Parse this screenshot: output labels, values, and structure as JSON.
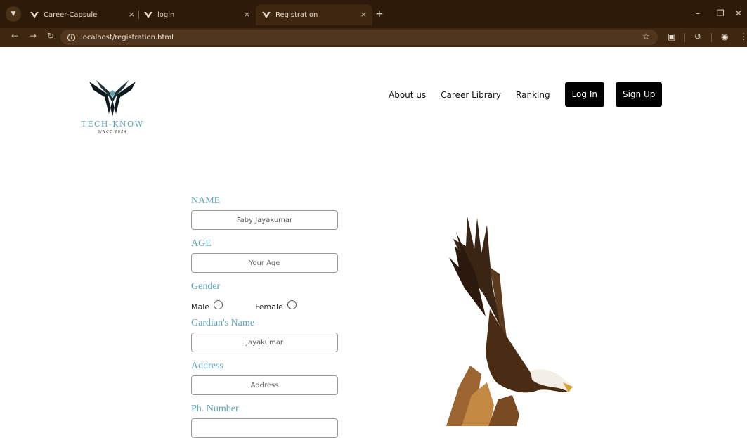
{
  "browser": {
    "tabs": [
      {
        "title": "Career-Capsule",
        "close": "×"
      },
      {
        "title": "login",
        "close": "×"
      },
      {
        "title": "Registration",
        "close": "×",
        "active": true
      }
    ],
    "new_tab": "+",
    "url": "localhost/registration.html",
    "accent_color": "#2d1a08"
  },
  "header": {
    "brand": "TECH-KNOW",
    "since": "SINCE 2024",
    "nav": {
      "about": "About us",
      "library": "Career Library",
      "ranking": "Ranking",
      "login": "Log In",
      "signup": "Sign Up"
    }
  },
  "form": {
    "name_label": "NAME",
    "name_value": "Faby Jayakumar",
    "age_label": "AGE",
    "age_placeholder": "Your Age",
    "gender_label": "Gender",
    "gender_options": [
      "Male",
      "Female"
    ],
    "guardian_label": "Gardian's Name",
    "guardian_value": "Jayakumar",
    "address_label": "Address",
    "address_placeholder": "Address",
    "phone_label": "Ph. Number"
  },
  "colors": {
    "label": "#5ea6bb",
    "button_bg": "#000000"
  }
}
